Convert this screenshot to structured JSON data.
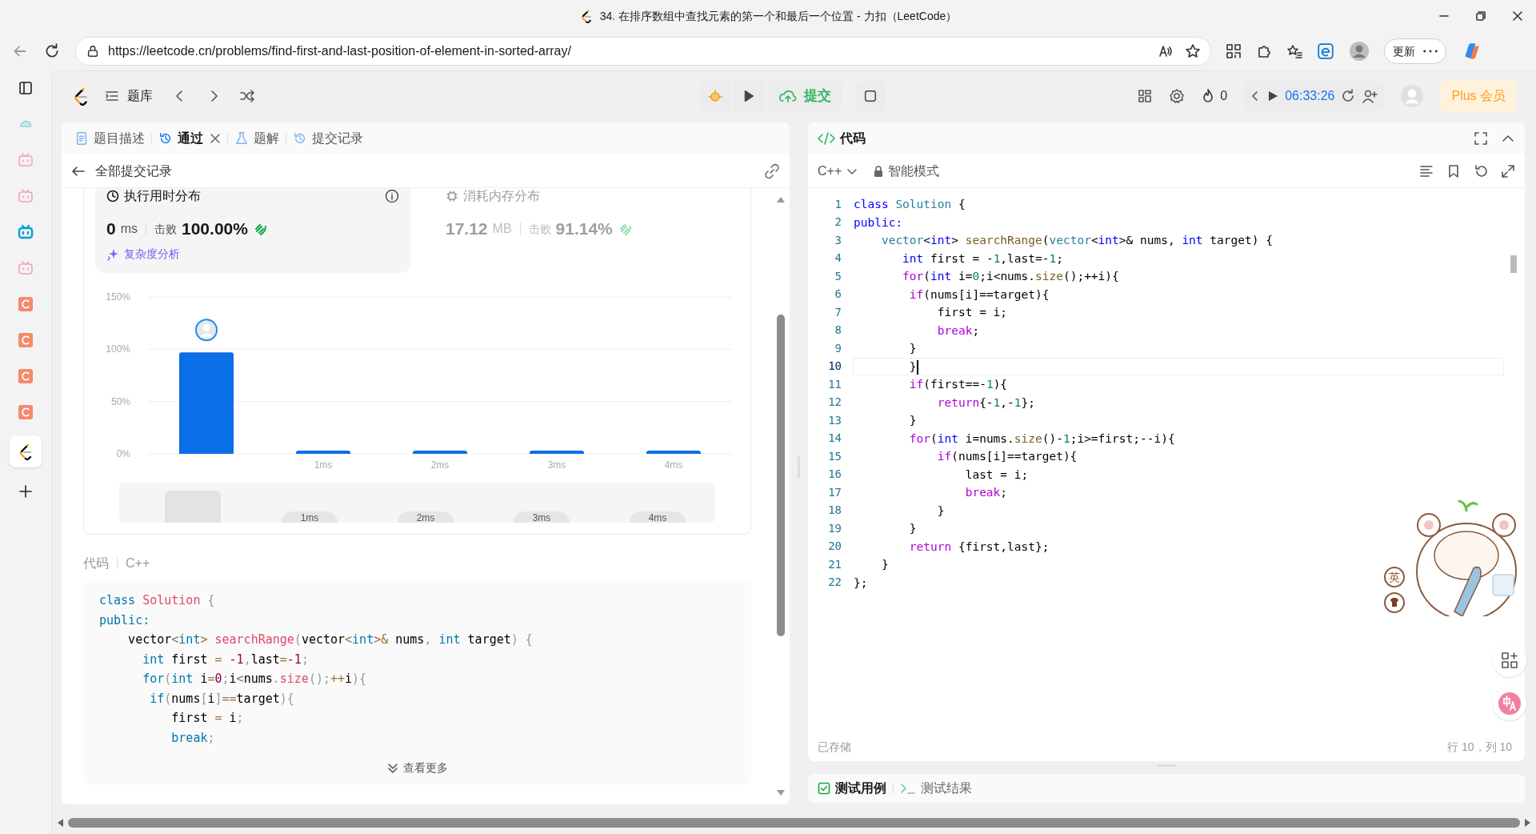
{
  "browser": {
    "title": "34. 在排序数组中查找元素的第一个和最后一个位置 - 力扣（LeetCode）",
    "url": "https://leetcode.cn/problems/find-first-and-last-position-of-element-in-sorted-array/",
    "update_button": "更新"
  },
  "sidebar": {
    "items": [
      {
        "kind": "tabs",
        "selected": false
      },
      {
        "kind": "cloud",
        "selected": false
      },
      {
        "kind": "tv",
        "selected": false
      },
      {
        "kind": "tv",
        "selected": false
      },
      {
        "kind": "tv-bold",
        "selected": false
      },
      {
        "kind": "tv",
        "selected": false
      },
      {
        "kind": "letter",
        "selected": false
      },
      {
        "kind": "letter",
        "selected": false
      },
      {
        "kind": "letter",
        "selected": false
      },
      {
        "kind": "letter",
        "selected": false
      },
      {
        "kind": "logo",
        "selected": true
      },
      {
        "kind": "add",
        "selected": false
      }
    ]
  },
  "toolbar": {
    "problem_list": "题库",
    "submit": "提交",
    "streak": "0",
    "timer": "06:33:26",
    "plus": "Plus 会员"
  },
  "left_panel": {
    "tabs": [
      {
        "label": "题目描述",
        "selected": false,
        "closable": false
      },
      {
        "label": "通过",
        "selected": true,
        "closable": true
      },
      {
        "label": "题解",
        "selected": false,
        "closable": false
      },
      {
        "label": "提交记录",
        "selected": false,
        "closable": false
      }
    ],
    "back_link": "全部提交记录",
    "stats": [
      {
        "title": "执行用时分布",
        "value": "0",
        "unit": "ms",
        "beats_label": "击败",
        "beats": "100.00%",
        "selected": true
      },
      {
        "title": "消耗内存分布",
        "value": "17.12",
        "unit": "MB",
        "beats_label": "击败",
        "beats": "91.14%",
        "selected": false
      }
    ],
    "analysis_link": "复杂度分析",
    "chart_data": {
      "type": "bar",
      "x": [
        0,
        1,
        2,
        3,
        4
      ],
      "values": [
        97,
        3,
        3,
        3,
        3
      ],
      "ylim": [
        0,
        150
      ],
      "yticks": [
        {
          "value": 0,
          "label": "0%"
        },
        {
          "value": 50,
          "label": "50%"
        },
        {
          "value": 100,
          "label": "100%"
        },
        {
          "value": 150,
          "label": "150%"
        }
      ],
      "xlim": [
        -0.5,
        4.5
      ],
      "xticks": [
        {
          "value": 1,
          "label": "1ms"
        },
        {
          "value": 2,
          "label": "2ms"
        },
        {
          "value": 3,
          "label": "3ms"
        },
        {
          "value": 4,
          "label": "4ms"
        }
      ]
    },
    "overview_labels": [
      "1ms",
      "2ms",
      "3ms",
      "4ms"
    ],
    "code_label": "代码",
    "language": "C++",
    "code": [
      [
        {
          "text": "class ",
          "kind": "k"
        },
        {
          "text": "Solution",
          "kind": "f"
        },
        {
          "text": " {",
          "kind": "g"
        }
      ],
      [
        {
          "text": "public:",
          "kind": "k"
        }
      ],
      [
        {
          "text": "    vector",
          "kind": "p"
        },
        {
          "text": "<",
          "kind": "o"
        },
        {
          "text": "int",
          "kind": "k"
        },
        {
          "text": "> ",
          "kind": "o"
        },
        {
          "text": "searchRange",
          "kind": "f"
        },
        {
          "text": "(",
          "kind": "g"
        },
        {
          "text": "vector",
          "kind": "p"
        },
        {
          "text": "<",
          "kind": "o"
        },
        {
          "text": "int",
          "kind": "k"
        },
        {
          "text": ">&",
          "kind": "o"
        },
        {
          "text": " nums",
          "kind": "p"
        },
        {
          "text": ",",
          "kind": "g"
        },
        {
          "text": " int",
          "kind": "k"
        },
        {
          "text": " target",
          "kind": "p"
        },
        {
          "text": ") {",
          "kind": "g"
        }
      ],
      [
        {
          "text": "      int",
          "kind": "k"
        },
        {
          "text": " first ",
          "kind": "p"
        },
        {
          "text": "=",
          "kind": "o"
        },
        {
          "text": " -1",
          "kind": "n"
        },
        {
          "text": ",",
          "kind": "g"
        },
        {
          "text": "last",
          "kind": "p"
        },
        {
          "text": "=",
          "kind": "o"
        },
        {
          "text": "-1",
          "kind": "n"
        },
        {
          "text": ";",
          "kind": "g"
        }
      ],
      [
        {
          "text": "      for",
          "kind": "k"
        },
        {
          "text": "(",
          "kind": "g"
        },
        {
          "text": "int",
          "kind": "k"
        },
        {
          "text": " i",
          "kind": "p"
        },
        {
          "text": "=",
          "kind": "o"
        },
        {
          "text": "0",
          "kind": "n"
        },
        {
          "text": ";",
          "kind": "g"
        },
        {
          "text": "i",
          "kind": "p"
        },
        {
          "text": "<",
          "kind": "o"
        },
        {
          "text": "nums",
          "kind": "p"
        },
        {
          "text": ".",
          "kind": "g"
        },
        {
          "text": "size",
          "kind": "f"
        },
        {
          "text": "();",
          "kind": "g"
        },
        {
          "text": "++",
          "kind": "o"
        },
        {
          "text": "i",
          "kind": "p"
        },
        {
          "text": "){",
          "kind": "g"
        }
      ],
      [
        {
          "text": "       if",
          "kind": "k"
        },
        {
          "text": "(",
          "kind": "g"
        },
        {
          "text": "nums",
          "kind": "p"
        },
        {
          "text": "[",
          "kind": "g"
        },
        {
          "text": "i",
          "kind": "p"
        },
        {
          "text": "]",
          "kind": "g"
        },
        {
          "text": "==",
          "kind": "o"
        },
        {
          "text": "target",
          "kind": "p"
        },
        {
          "text": "){",
          "kind": "g"
        }
      ],
      [
        {
          "text": "          first ",
          "kind": "p"
        },
        {
          "text": "=",
          "kind": "o"
        },
        {
          "text": " i",
          "kind": "p"
        },
        {
          "text": ";",
          "kind": "g"
        }
      ],
      [
        {
          "text": "          break",
          "kind": "k"
        },
        {
          "text": ";",
          "kind": "g"
        }
      ]
    ],
    "more_button": "查看更多"
  },
  "editor": {
    "title": "代码",
    "language": "C++",
    "mode": "智能模式",
    "lines": [
      {
        "n": "1",
        "active": false,
        "tokens": [
          {
            "text": "class ",
            "kind": "k"
          },
          {
            "text": "Solution",
            "kind": "t"
          },
          {
            "text": " {",
            "kind": "p"
          }
        ]
      },
      {
        "n": "2",
        "active": false,
        "tokens": [
          {
            "text": "public:",
            "kind": "k"
          }
        ]
      },
      {
        "n": "3",
        "active": false,
        "tokens": [
          {
            "text": "    vector",
            "kind": "t"
          },
          {
            "text": "<",
            "kind": "p"
          },
          {
            "text": "int",
            "kind": "k"
          },
          {
            "text": "> ",
            "kind": "p"
          },
          {
            "text": "searchRange",
            "kind": "f"
          },
          {
            "text": "(",
            "kind": "p"
          },
          {
            "text": "vector",
            "kind": "t"
          },
          {
            "text": "<",
            "kind": "p"
          },
          {
            "text": "int",
            "kind": "k"
          },
          {
            "text": ">& nums, ",
            "kind": "p"
          },
          {
            "text": "int",
            "kind": "k"
          },
          {
            "text": " target) {",
            "kind": "p"
          }
        ]
      },
      {
        "n": "4",
        "active": false,
        "tokens": [
          {
            "text": "       int",
            "kind": "k"
          },
          {
            "text": " first = -",
            "kind": "p"
          },
          {
            "text": "1",
            "kind": "n"
          },
          {
            "text": ",last=-",
            "kind": "p"
          },
          {
            "text": "1",
            "kind": "n"
          },
          {
            "text": ";",
            "kind": "p"
          }
        ]
      },
      {
        "n": "5",
        "active": false,
        "tokens": [
          {
            "text": "       for",
            "kind": "c"
          },
          {
            "text": "(",
            "kind": "p"
          },
          {
            "text": "int",
            "kind": "k"
          },
          {
            "text": " i=",
            "kind": "p"
          },
          {
            "text": "0",
            "kind": "n"
          },
          {
            "text": ";i<nums.",
            "kind": "p"
          },
          {
            "text": "size",
            "kind": "f"
          },
          {
            "text": "();++i){",
            "kind": "p"
          }
        ]
      },
      {
        "n": "6",
        "active": false,
        "tokens": [
          {
            "text": "        if",
            "kind": "c"
          },
          {
            "text": "(nums[i]==target){",
            "kind": "p"
          }
        ]
      },
      {
        "n": "7",
        "active": false,
        "tokens": [
          {
            "text": "            first = i;",
            "kind": "p"
          }
        ]
      },
      {
        "n": "8",
        "active": false,
        "tokens": [
          {
            "text": "            break",
            "kind": "c"
          },
          {
            "text": ";",
            "kind": "p"
          }
        ]
      },
      {
        "n": "9",
        "active": false,
        "tokens": [
          {
            "text": "        }",
            "kind": "p"
          }
        ]
      },
      {
        "n": "10",
        "active": true,
        "tokens": [
          {
            "text": "        }",
            "kind": "p"
          }
        ]
      },
      {
        "n": "11",
        "active": false,
        "tokens": [
          {
            "text": "        if",
            "kind": "c"
          },
          {
            "text": "(first==-",
            "kind": "p"
          },
          {
            "text": "1",
            "kind": "n"
          },
          {
            "text": "){",
            "kind": "p"
          }
        ]
      },
      {
        "n": "12",
        "active": false,
        "tokens": [
          {
            "text": "            return",
            "kind": "c"
          },
          {
            "text": "{-",
            "kind": "p"
          },
          {
            "text": "1",
            "kind": "n"
          },
          {
            "text": ",-",
            "kind": "p"
          },
          {
            "text": "1",
            "kind": "n"
          },
          {
            "text": "};",
            "kind": "p"
          }
        ]
      },
      {
        "n": "13",
        "active": false,
        "tokens": [
          {
            "text": "        }",
            "kind": "p"
          }
        ]
      },
      {
        "n": "14",
        "active": false,
        "tokens": [
          {
            "text": "        for",
            "kind": "c"
          },
          {
            "text": "(",
            "kind": "p"
          },
          {
            "text": "int",
            "kind": "k"
          },
          {
            "text": " i=nums.",
            "kind": "p"
          },
          {
            "text": "size",
            "kind": "f"
          },
          {
            "text": "()-",
            "kind": "p"
          },
          {
            "text": "1",
            "kind": "n"
          },
          {
            "text": ";i>=first;--i){",
            "kind": "p"
          }
        ]
      },
      {
        "n": "15",
        "active": false,
        "tokens": [
          {
            "text": "            if",
            "kind": "c"
          },
          {
            "text": "(nums[i]==target){",
            "kind": "p"
          }
        ]
      },
      {
        "n": "16",
        "active": false,
        "tokens": [
          {
            "text": "                last = i;",
            "kind": "p"
          }
        ]
      },
      {
        "n": "17",
        "active": false,
        "tokens": [
          {
            "text": "                break",
            "kind": "c"
          },
          {
            "text": ";",
            "kind": "p"
          }
        ]
      },
      {
        "n": "18",
        "active": false,
        "tokens": [
          {
            "text": "            }",
            "kind": "p"
          }
        ]
      },
      {
        "n": "19",
        "active": false,
        "tokens": [
          {
            "text": "        }",
            "kind": "p"
          }
        ]
      },
      {
        "n": "20",
        "active": false,
        "tokens": [
          {
            "text": "        return",
            "kind": "c"
          },
          {
            "text": " {first,last};",
            "kind": "p"
          }
        ]
      },
      {
        "n": "21",
        "active": false,
        "tokens": [
          {
            "text": "    }",
            "kind": "p"
          }
        ]
      },
      {
        "n": "22",
        "active": false,
        "tokens": [
          {
            "text": "};",
            "kind": "p"
          }
        ]
      }
    ],
    "saved": "已存储",
    "position": "行 10，列 10"
  },
  "bottom_tabs": [
    {
      "label": "测试用例",
      "selected": true
    },
    {
      "label": "测试结果",
      "selected": false
    }
  ],
  "ime": {
    "label": "英"
  }
}
